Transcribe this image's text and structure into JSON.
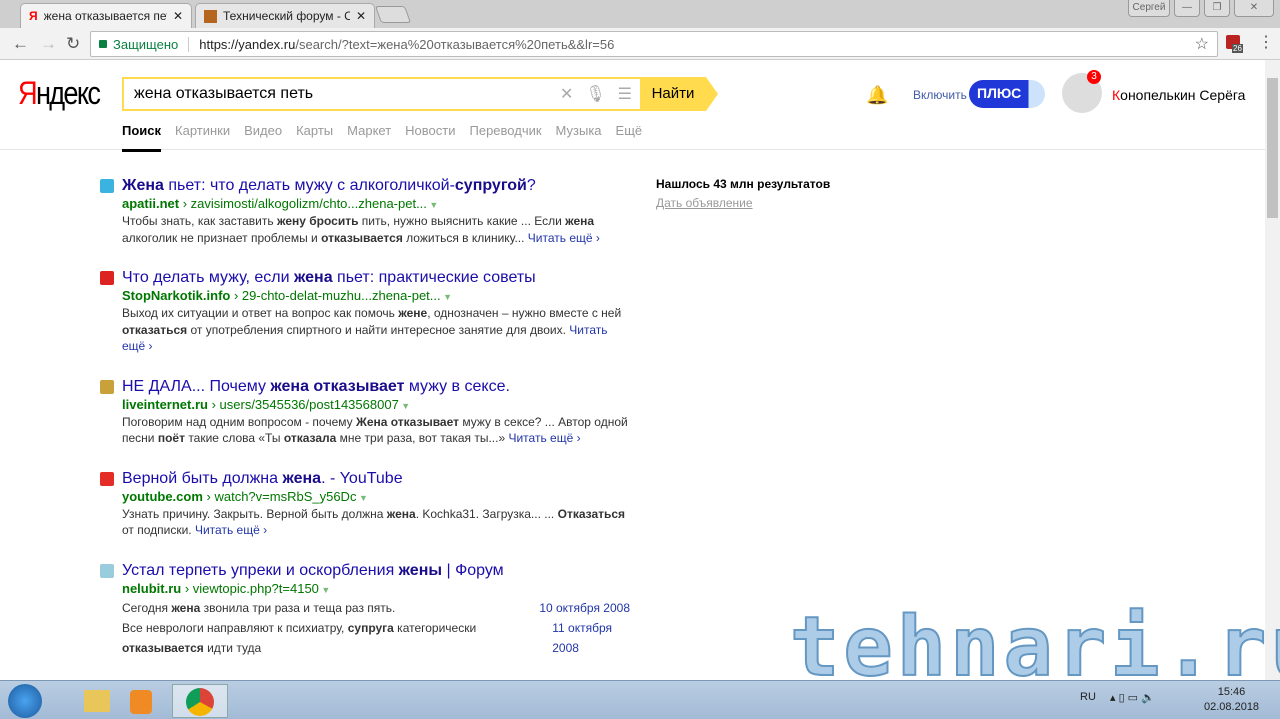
{
  "browser": {
    "tabs": [
      {
        "label": "жена отказывается петь",
        "icon": "yandex-icon"
      },
      {
        "label": "Технический форум - Со",
        "icon": "forum-icon"
      }
    ],
    "user_badge": "Сергей",
    "secure_label": "Защищено",
    "url_host": "https://yandex.ru",
    "url_path": "/search/?text=жена%20отказывается%20петь&&lr=56",
    "ext_count": "26"
  },
  "header": {
    "logo": "Яндекс",
    "query": "жена отказывается петь",
    "find": "Найти",
    "plus_enable": "Включить",
    "plus": "ПЛЮС",
    "notif_count": "3",
    "user_first": "К",
    "user_rest": "онопелькин Серёга",
    "tabs": [
      "Поиск",
      "Картинки",
      "Видео",
      "Карты",
      "Маркет",
      "Новости",
      "Переводчик",
      "Музыка",
      "Ещё"
    ]
  },
  "results": [
    {
      "title": [
        {
          "t": "Жена",
          "b": true
        },
        {
          "t": " пьет: что делать мужу с алкоголичкой-"
        },
        {
          "t": "супругой",
          "b": true
        },
        {
          "t": "?"
        }
      ],
      "host": "apatii.net",
      "path": "zavisimosti/alkogolizm/chto...zhena-pet...",
      "fav": "#3bb3e0",
      "snippet": [
        {
          "t": "Чтобы знать, как заставить "
        },
        {
          "t": "жену бросить",
          "b": true
        },
        {
          "t": " пить, нужно выяснить какие ... Если "
        },
        {
          "t": "жена",
          "b": true
        },
        {
          "t": " алкоголик не признает проблемы и "
        },
        {
          "t": "отказывается",
          "b": true
        },
        {
          "t": " ложиться в клинику... "
        }
      ],
      "more": "Читать ещё ›"
    },
    {
      "title": [
        {
          "t": "Что делать мужу, если "
        },
        {
          "t": "жена",
          "b": true
        },
        {
          "t": " пьет: практические советы"
        }
      ],
      "host": "StopNarkotik.info",
      "path": "29-chto-delat-muzhu...zhena-pet...",
      "fav": "#d22",
      "snippet": [
        {
          "t": "Выход их ситуации и ответ на вопрос как помочь "
        },
        {
          "t": "жене",
          "b": true
        },
        {
          "t": ", однозначен – нужно вместе с ней "
        },
        {
          "t": "отказаться",
          "b": true
        },
        {
          "t": " от употребления спиртного и найти интересное занятие для двоих. "
        }
      ],
      "more": "Читать ещё ›"
    },
    {
      "title": [
        {
          "t": "НЕ ДАЛА... Почему "
        },
        {
          "t": "жена отказывает",
          "b": true
        },
        {
          "t": " мужу в сексе."
        }
      ],
      "host": "liveinternet.ru",
      "path": "users/3545536/post143568007",
      "fav": "#c9a13a",
      "snippet": [
        {
          "t": "Поговорим над одним вопросом - почему "
        },
        {
          "t": "Жена отказывает",
          "b": true
        },
        {
          "t": " мужу в сексе? ... Автор одной песни "
        },
        {
          "t": "поёт",
          "b": true
        },
        {
          "t": " такие слова «Ты "
        },
        {
          "t": "отказала",
          "b": true
        },
        {
          "t": " мне три раза, вот такая ты...» "
        }
      ],
      "more": "Читать ещё ›"
    },
    {
      "title": [
        {
          "t": "Верной быть должна "
        },
        {
          "t": "жена",
          "b": true
        },
        {
          "t": ". - YouTube"
        }
      ],
      "host": "youtube.com",
      "path": "watch?v=msRbS_y56Dc",
      "fav": "#e52d27",
      "snippet": [
        {
          "t": "Узнать причину. Закрыть. Верной быть должна "
        },
        {
          "t": "жена",
          "b": true
        },
        {
          "t": ". Kochka31. Загрузка... ... "
        },
        {
          "t": "Отказаться",
          "b": true
        },
        {
          "t": " от подписки. "
        }
      ],
      "more": "Читать ещё ›"
    }
  ],
  "forum_result": {
    "title": [
      {
        "t": "Устал терпеть упреки и оскорбления "
      },
      {
        "t": "жены",
        "b": true
      },
      {
        "t": " | Форум"
      }
    ],
    "host": "nelubit.ru",
    "path": "viewtopic.php?t=4150",
    "fav": "#9cd",
    "posts": [
      {
        "text": [
          {
            "t": "Сегодня "
          },
          {
            "t": "жена",
            "b": true
          },
          {
            "t": " звонила три раза и теща раз пять."
          }
        ],
        "date": "10 октября 2008"
      },
      {
        "text": [
          {
            "t": "Все неврологи направляют к психиатру, "
          },
          {
            "t": "супруга",
            "b": true
          },
          {
            "t": " категорически "
          },
          {
            "t": "отказывается",
            "b": true
          },
          {
            "t": " идти туда"
          }
        ],
        "date": "11 октября 2008"
      }
    ]
  },
  "sidebar": {
    "count": "Нашлось 43 млн результатов",
    "ad": "Дать объявление"
  },
  "watermark": "tehnari.ru",
  "taskbar": {
    "lang": "RU",
    "time": "15:46",
    "date": "02.08.2018"
  }
}
